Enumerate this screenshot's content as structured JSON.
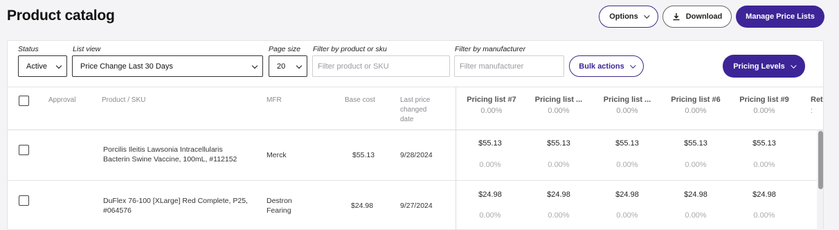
{
  "page": {
    "title": "Product catalog"
  },
  "header": {
    "options_label": "Options",
    "download_label": "Download",
    "manage_label": "Manage Price Lists"
  },
  "filters": {
    "status": {
      "label": "Status",
      "value": "Active"
    },
    "list_view": {
      "label": "List view",
      "value": "Price Change Last 30 Days"
    },
    "page_size": {
      "label": "Page size",
      "value": "20"
    },
    "product": {
      "label": "Filter by product or sku",
      "placeholder": "Filter product or SKU"
    },
    "manufacturer": {
      "label": "Filter by manufacturer",
      "placeholder": "Filter manufacturer"
    },
    "bulk_label": "Bulk actions",
    "pricing_levels_label": "Pricing Levels"
  },
  "table": {
    "columns": {
      "approval": "Approval",
      "product": "Product / SKU",
      "mfr": "MFR",
      "base_cost": "Base cost",
      "last_price_1": "Last price",
      "last_price_2": "changed",
      "last_price_3": "date"
    },
    "pricing_columns": [
      {
        "name": "Pricing list #7",
        "pct": "0.00%"
      },
      {
        "name": "Pricing list ...",
        "pct": "0.00%"
      },
      {
        "name": "Pricing list ...",
        "pct": "0.00%"
      },
      {
        "name": "Pricing list #6",
        "pct": "0.00%"
      },
      {
        "name": "Pricing list #9",
        "pct": "0.00%"
      },
      {
        "name": "Ret",
        "pct": ":"
      }
    ],
    "rows": [
      {
        "product_line1": "Porcilis Ileitis Lawsonia Intracellularis",
        "product_line2": "Bacterin Swine Vaccine, 100mL, #112152",
        "mfr_line1": "Merck",
        "mfr_line2": "",
        "base_cost": "$55.13",
        "date": "9/28/2024",
        "prices": [
          {
            "price": "$55.13",
            "pct": "0.00%"
          },
          {
            "price": "$55.13",
            "pct": "0.00%"
          },
          {
            "price": "$55.13",
            "pct": "0.00%"
          },
          {
            "price": "$55.13",
            "pct": "0.00%"
          },
          {
            "price": "$55.13",
            "pct": "0.00%"
          }
        ]
      },
      {
        "product_line1": "DuFlex 76-100 [XLarge] Red Complete, P25,",
        "product_line2": "#064576",
        "mfr_line1": "Destron",
        "mfr_line2": "Fearing",
        "base_cost": "$24.98",
        "date": "9/27/2024",
        "prices": [
          {
            "price": "$24.98",
            "pct": "0.00%"
          },
          {
            "price": "$24.98",
            "pct": "0.00%"
          },
          {
            "price": "$24.98",
            "pct": "0.00%"
          },
          {
            "price": "$24.98",
            "pct": "0.00%"
          },
          {
            "price": "$24.98",
            "pct": "0.00%"
          }
        ]
      }
    ]
  },
  "colors": {
    "accent": "#3d2598",
    "border": "#e3e3e6"
  }
}
